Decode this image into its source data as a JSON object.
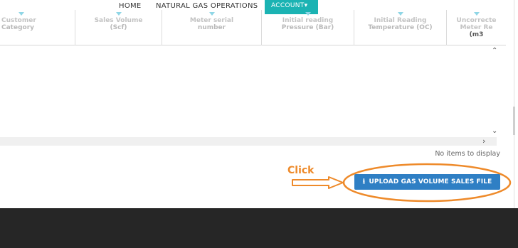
{
  "nav": {
    "home": "HOME",
    "operations": "NATURAL GAS OPERATIONS",
    "account": "ACCOUNT▾"
  },
  "grid": {
    "columns": [
      {
        "line1": "Customer",
        "line2": "Category"
      },
      {
        "line1": "Sales Volume",
        "line2": "(Scf)"
      },
      {
        "line1": "Meter serial",
        "line2": "number"
      },
      {
        "line1": "Initial reading",
        "line2": "Pressure (Bar)"
      },
      {
        "line1": "Initial Reading",
        "line2": "Temperature (OC)"
      },
      {
        "line1": "Uncorrecte",
        "line2": "Meter Re",
        "line3": "(m3"
      }
    ],
    "empty_message": "No items to display"
  },
  "annotation": {
    "click_label": "Click",
    "highlight_color": "#ee8a2a"
  },
  "upload_button": {
    "label": "UPLOAD GAS VOLUME SALES FILE",
    "icon": "upload-icon",
    "color": "#2f7fc4"
  },
  "colors": {
    "account_bg": "#1bb3b3",
    "footer_bg": "#262626",
    "filter_icon": "#8fd6e6"
  }
}
